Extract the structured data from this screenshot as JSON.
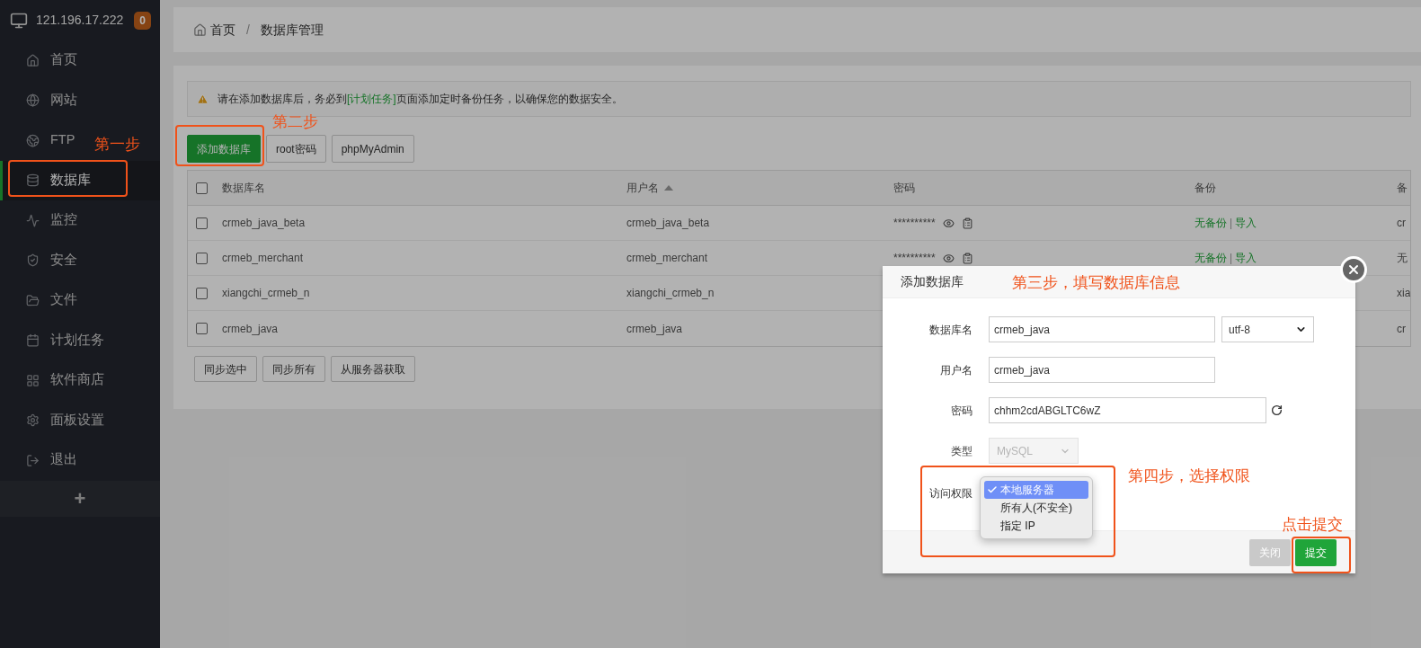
{
  "sidebar": {
    "host": "121.196.17.222",
    "badge": "0",
    "items": [
      {
        "label": "首页",
        "selected": false
      },
      {
        "label": "网站",
        "selected": false
      },
      {
        "label": "FTP",
        "selected": false
      },
      {
        "label": "数据库",
        "selected": true
      },
      {
        "label": "监控",
        "selected": false
      },
      {
        "label": "安全",
        "selected": false
      },
      {
        "label": "文件",
        "selected": false
      },
      {
        "label": "计划任务",
        "selected": false
      },
      {
        "label": "软件商店",
        "selected": false
      },
      {
        "label": "面板设置",
        "selected": false
      },
      {
        "label": "退出",
        "selected": false
      }
    ],
    "add": "+"
  },
  "breadcrumb": {
    "home": "首页",
    "separator": "/",
    "current": "数据库管理"
  },
  "alert": {
    "before": "请在添加数据库后，务必到",
    "link": "[计划任务]",
    "after": "页面添加定时备份任务，以确保您的数据安全。"
  },
  "toolbar": [
    {
      "label": "添加数据库",
      "primary": true
    },
    {
      "label": "root密码",
      "primary": false
    },
    {
      "label": "phpMyAdmin",
      "primary": false
    }
  ],
  "table": {
    "all_checked": false,
    "columns": [
      {
        "label": "数据库名",
        "sorted": false
      },
      {
        "label": "用户名",
        "sorted": true
      },
      {
        "label": "密码",
        "sorted": false
      },
      {
        "label": "备份",
        "sorted": false
      },
      {
        "label": "备",
        "sorted": false
      }
    ],
    "rows": [
      {
        "checked": false,
        "name": "crmeb_java_beta",
        "user": "crmeb_java_beta",
        "password": "**********",
        "backup": "无备份",
        "separator": "|",
        "import": "导入",
        "column_5": "cr"
      },
      {
        "checked": false,
        "name": "crmeb_merchant",
        "user": "crmeb_merchant",
        "password": "**********",
        "backup": "无备份",
        "separator": "|",
        "import": "导入",
        "column_5": "无"
      },
      {
        "checked": false,
        "name": "xiangchi_crmeb_n",
        "user": "xiangchi_crmeb_n",
        "column_5": "xia"
      },
      {
        "checked": false,
        "name": "crmeb_java",
        "user": "crmeb_java",
        "column_5": "cr"
      }
    ]
  },
  "table_buttons": [
    "同步选中",
    "同步所有",
    "从服务器获取"
  ],
  "dialog": {
    "title": "添加数据库",
    "fields": [
      {
        "kind": "input-select",
        "label": "数据库名",
        "value": "crmeb_java",
        "select": "utf-8"
      },
      {
        "kind": "input",
        "label": "用户名",
        "value": "crmeb_java"
      },
      {
        "kind": "input-refresh",
        "label": "密码",
        "value": "chhm2cdABGLTC6wZ"
      },
      {
        "kind": "disabled-select",
        "label": "类型",
        "value": "MySQL"
      }
    ],
    "access": {
      "label": "访问权限",
      "options": [
        {
          "label": "本地服务器",
          "selected": true
        },
        {
          "label": "所有人(不安全)",
          "selected": false
        },
        {
          "label": "指定 IP",
          "selected": false
        }
      ]
    },
    "buttons": [
      {
        "label": "关闭",
        "primary": false
      },
      {
        "label": "提交",
        "primary": true
      }
    ]
  },
  "annotations": [
    "第一步",
    "第二步",
    "第三步，填写数据库信息",
    "第四步，选择权限",
    "点击提交"
  ]
}
